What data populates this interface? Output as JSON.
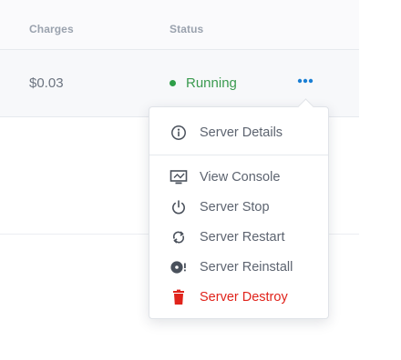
{
  "table": {
    "headers": {
      "charges": "Charges",
      "status": "Status"
    },
    "rows": [
      {
        "charges": "$0.03",
        "status": "Running",
        "status_color": "#2e9e48"
      }
    ],
    "more_icon": "more-dots-icon",
    "accent_color": "#1a7fd4"
  },
  "menu": {
    "items": [
      {
        "label": "Server Details",
        "icon": "info-icon"
      },
      {
        "label": "View Console",
        "icon": "console-icon"
      },
      {
        "label": "Server Stop",
        "icon": "power-icon"
      },
      {
        "label": "Server Restart",
        "icon": "restart-icon"
      },
      {
        "label": "Server Reinstall",
        "icon": "reinstall-icon"
      },
      {
        "label": "Server Destroy",
        "icon": "trash-icon",
        "danger_color": "#e0231b"
      }
    ]
  }
}
